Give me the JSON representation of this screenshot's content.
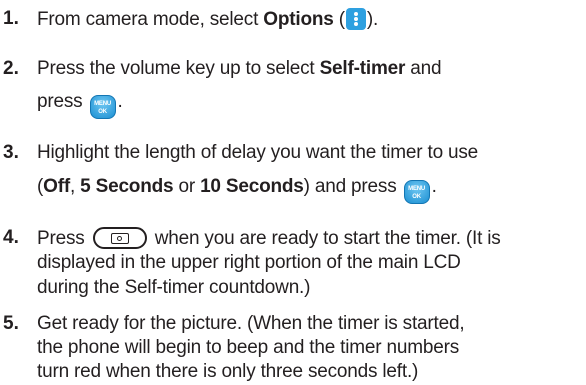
{
  "steps": [
    {
      "number": "1.",
      "line1_pre": "From camera mode, select ",
      "line1_bold": "Options",
      "line1_post1": " (",
      "line1_post2": ")."
    },
    {
      "number": "2.",
      "line1_pre": "Press the volume key up to select ",
      "line1_bold": "Self-timer",
      "line1_post": " and",
      "line2_pre": "press ",
      "line2_post": "."
    },
    {
      "number": "3.",
      "line1": "Highlight the length of delay you want the timer to use",
      "line2_open": "(",
      "opt_off": "Off",
      "sep1": ", ",
      "opt_5": "5 Seconds",
      "sep2": " or ",
      "opt_10": "10 Seconds",
      "line2_post": ") and press ",
      "line2_end": "."
    },
    {
      "number": "4.",
      "line1_pre": "Press ",
      "line1_post": " when you are ready to start the timer. (It is",
      "line2": "displayed in the upper right portion of the main LCD",
      "line3": "during the Self-timer countdown.)"
    },
    {
      "number": "5.",
      "line1": "Get ready for the picture. (When the timer is started,",
      "line2": "the phone will begin to beep and the timer numbers",
      "line3": "turn red when there is only three seconds left.)"
    }
  ],
  "icons": {
    "options_icon": "options-icon",
    "menu_key_label_top": "MENU",
    "menu_key_label_bottom": "OK",
    "camera_key_icon": "camera-icon"
  }
}
